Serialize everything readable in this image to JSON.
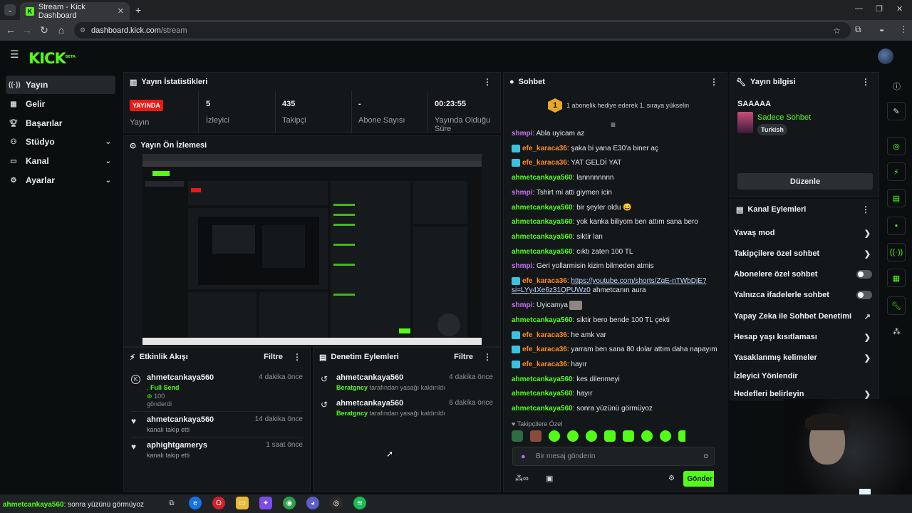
{
  "browser": {
    "tab_title": "Stream - Kick Dashboard",
    "url_host": "dashboard.kick.com",
    "url_path": "/stream"
  },
  "app": {
    "logo": "KICK",
    "logo_sup": "BETA"
  },
  "sidebar": {
    "items": [
      {
        "label": "Yayın",
        "icon": "broadcast-icon"
      },
      {
        "label": "Gelir",
        "icon": "revenue-icon"
      },
      {
        "label": "Başarılar",
        "icon": "trophy-icon"
      },
      {
        "label": "Stüdyo",
        "icon": "studio-icon"
      },
      {
        "label": "Kanal",
        "icon": "channel-icon"
      },
      {
        "label": "Ayarlar",
        "icon": "gear-icon"
      }
    ]
  },
  "stats": {
    "title": "Yayın İstatistikleri",
    "live_badge": "YAYINDA",
    "live_label": "Yayın",
    "viewers_value": "5",
    "viewers_label": "İzleyici",
    "followers_value": "435",
    "followers_label": "Takipçi",
    "subs_value": "-",
    "subs_label": "Abone Sayısı",
    "duration_value": "00:23:55",
    "duration_label": "Yayında Olduğu Süre"
  },
  "preview": {
    "title": "Yayın Ön İzlemesi"
  },
  "activity": {
    "title": "Etkinlik Akışı",
    "filter": "Filtre",
    "items": [
      {
        "user": "ahmetcankaya560",
        "time": "4 dakika önce",
        "line1": ", ",
        "highlight": "Full Send",
        "amount": "100",
        "line2": "gönderdi"
      },
      {
        "user": "ahmetcankaya560",
        "time": "14 dakika önce",
        "sub": "kanalı takip etti"
      },
      {
        "user": "aphightgamerys",
        "time": "1 saat önce",
        "sub": "kanalı takip etti"
      }
    ]
  },
  "moderation": {
    "title": "Denetim Eylemleri",
    "filter": "Filtre",
    "items": [
      {
        "user": "ahmetcankaya560",
        "time": "4 dakika önce",
        "actor": "Beratgncy",
        "action": " tarafından yasağı kaldırıldı"
      },
      {
        "user": "ahmetcankaya560",
        "time": "6 dakika önce",
        "actor": "Beratgncy",
        "action": " tarafından yasağı kaldırıldı"
      }
    ]
  },
  "chat": {
    "title": "Sohbet",
    "gift_text": "1 abonelik hediye ederek 1. sıraya yükselin",
    "gift_rank": "1",
    "messages": [
      {
        "user": "shmpi",
        "color": "pink",
        "badge": false,
        "text": "Abla uyicam az"
      },
      {
        "user": "efe_karaca36",
        "color": "orange",
        "badge": true,
        "text": "şaka bi yana E30'a biner aç"
      },
      {
        "user": "efe_karaca36",
        "color": "orange",
        "badge": true,
        "text": "YAT GELDİ YAT"
      },
      {
        "user": "ahmetcankaya560",
        "color": "green",
        "badge": false,
        "text": "lannnnnnnn"
      },
      {
        "user": "shmpi",
        "color": "pink",
        "badge": false,
        "text": "Tshirt mi atti giymen icin"
      },
      {
        "user": "ahmetcankaya560",
        "color": "green",
        "badge": false,
        "text": "bir şeyler oldu 😀"
      },
      {
        "user": "ahmetcankaya560",
        "color": "green",
        "badge": false,
        "text": "yok kanka biliyom ben attım sana bero"
      },
      {
        "user": "ahmetcankaya560",
        "color": "green",
        "badge": false,
        "text": "siktir lan"
      },
      {
        "user": "ahmetcankaya560",
        "color": "green",
        "badge": false,
        "text": "cıktı zaten 100 TL"
      },
      {
        "user": "shmpi",
        "color": "pink",
        "badge": false,
        "text": "Geri yollarmisin kizim bilmeden atmis"
      },
      {
        "user": "efe_karaca36",
        "color": "orange",
        "badge": true,
        "link": "https://youtube.com/shorts/ZqE-nTWbDjE?si=LYy4Xe6z31QPUWz0",
        "text": " ahmetcanın aura"
      },
      {
        "user": "shmpi",
        "color": "pink",
        "badge": false,
        "text": "Uyicamya"
      },
      {
        "user": "ahmetcankaya560",
        "color": "green",
        "badge": false,
        "text": "siktir bero bende 100 TL çekti"
      },
      {
        "user": "efe_karaca36",
        "color": "orange",
        "badge": true,
        "text": "he amk var"
      },
      {
        "user": "efe_karaca36",
        "color": "orange",
        "badge": true,
        "text": "yarram ben sana 80 dolar attım daha napayım"
      },
      {
        "user": "efe_karaca36",
        "color": "orange",
        "badge": true,
        "text": "hayır"
      },
      {
        "user": "ahmetcankaya560",
        "color": "green",
        "badge": false,
        "text": "kes dilenmeyi"
      },
      {
        "user": "ahmetcankaya560",
        "color": "green",
        "badge": false,
        "text": "hayır"
      },
      {
        "user": "ahmetcankaya560",
        "color": "green",
        "badge": false,
        "text": "sonra yüzünü görmüyoz"
      }
    ],
    "followers_only": "Takipçilere Özel",
    "input_placeholder": "Bir mesaj gönderin",
    "send_label": "Gönder"
  },
  "stream_info": {
    "title": "Yayın bilgisi",
    "stream_title": "SAAAAA",
    "category": "Sadece Sohbet",
    "language_tag": "Turkish",
    "edit_label": "Düzenle"
  },
  "channel_actions": {
    "title": "Kanal Eylemleri",
    "items": [
      {
        "label": "Yavaş mod",
        "control": "arrow"
      },
      {
        "label": "Takipçilere özel sohbet",
        "control": "arrow"
      },
      {
        "label": "Abonelere özel sohbet",
        "control": "toggle"
      },
      {
        "label": "Yalnızca ifadelerle sohbet",
        "control": "toggle"
      },
      {
        "label": "Yapay Zeka ile Sohbet Denetimi",
        "control": "external"
      },
      {
        "label": "Hesap yaşı kısıtlaması",
        "control": "arrow"
      },
      {
        "label": "Yasaklanmış kelimeler",
        "control": "arrow"
      },
      {
        "label": "İzleyici Yönlendir",
        "control": "none"
      },
      {
        "label": "Hedefleri belirleyin",
        "control": "arrow"
      }
    ]
  },
  "overlay_chat": {
    "user": "ahmetcankaya560",
    "text": ": sonra yüzünü görmüyoz"
  },
  "colors": {
    "accent": "#53fc18",
    "live": "#e91916",
    "panel": "#141719",
    "bg": "#0b0e0f"
  }
}
